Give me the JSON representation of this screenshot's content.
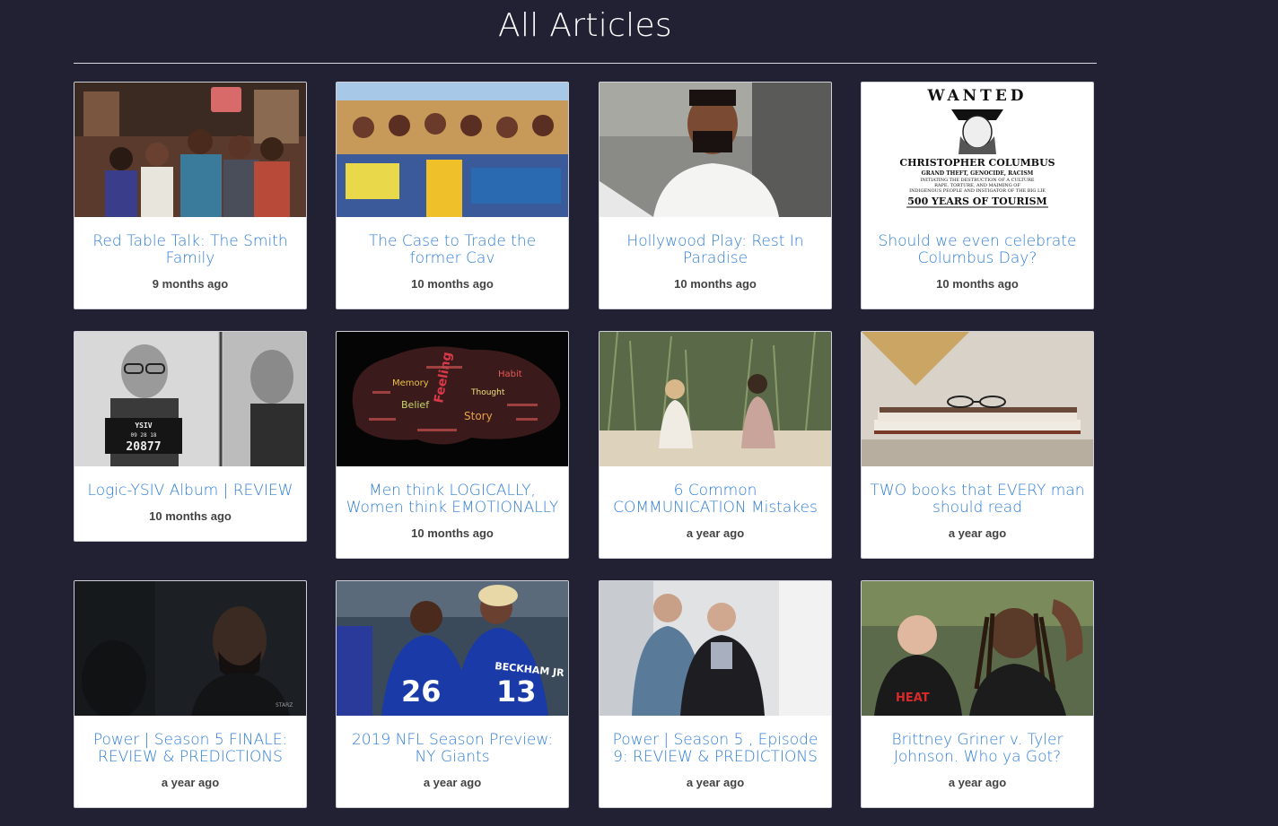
{
  "page": {
    "title": "All Articles"
  },
  "articles": [
    {
      "title": "Red Table Talk: The Smith Family",
      "date": "9 months ago",
      "thumb": "red-table-talk-photo"
    },
    {
      "title": "The Case to Trade the former Cav",
      "date": "10 months ago",
      "thumb": "lebron-mural-photo"
    },
    {
      "title": "Hollywood Play: Rest In Paradise",
      "date": "10 months ago",
      "thumb": "selfie-man-photo"
    },
    {
      "title": "Should we even celebrate Columbus Day?",
      "date": "10 months ago",
      "thumb": "wanted-poster-image",
      "poster": {
        "heading": "WANTED",
        "name": "CHRISTOPHER COLUMBUS",
        "line1": "GRAND THEFT, GENOCIDE, RACISM",
        "line2": "INITIATING THE DESTRUCTION OF A CULTURE",
        "line3": "RAPE, TORTURE, AND MAIMING OF",
        "line4": "INDIGENOUS PEOPLE AND INSTIGATOR OF THE BIG LIE",
        "footer": "500 YEARS OF TOURISM"
      }
    },
    {
      "title": "Logic-YSIV Album | REVIEW",
      "date": "10 months ago",
      "thumb": "mugshot-photo",
      "placard": {
        "name": "YSIV",
        "date": "09 28 18",
        "number": "20877"
      }
    },
    {
      "title": "Men think LOGICALLY, Women think EMOTIONALLY",
      "date": "10 months ago",
      "thumb": "brain-wordcloud-image",
      "words": [
        "Memory",
        "Feeling",
        "Story",
        "Belief",
        "Thought",
        "Habit"
      ]
    },
    {
      "title": "6 Common COMMUNICATION Mistakes",
      "date": "a year ago",
      "thumb": "two-women-beach-photo"
    },
    {
      "title": "TWO books that EVERY man should read",
      "date": "a year ago",
      "thumb": "books-glasses-photo"
    },
    {
      "title": "Power | Season 5 FINALE: REVIEW & PREDICTIONS",
      "date": "a year ago",
      "thumb": "power-scene-photo",
      "watermark": "STARZ"
    },
    {
      "title": "2019 NFL Season Preview: NY Giants",
      "date": "a year ago",
      "thumb": "giants-players-photo",
      "jerseys": {
        "left": "26",
        "right": "13",
        "name": "BECKHAM JR"
      }
    },
    {
      "title": "Power | Season 5 , Episode 9: REVIEW & PREDICTIONS",
      "date": "a year ago",
      "thumb": "power-episode-photo"
    },
    {
      "title": "Brittney Griner v. Tyler Johnson. Who ya Got?",
      "date": "a year ago",
      "thumb": "griner-johnson-photo",
      "jersey_text": "HEAT"
    }
  ]
}
